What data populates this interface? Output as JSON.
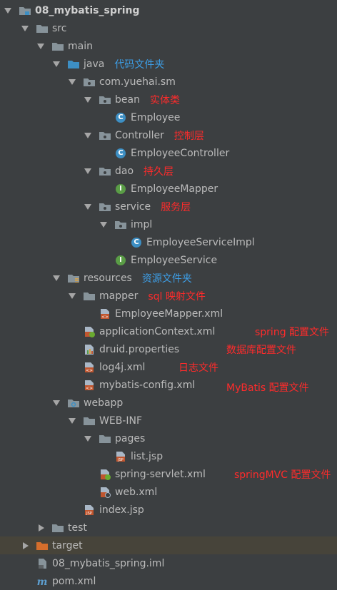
{
  "tree": {
    "project": "08_mybatis_spring",
    "src": "src",
    "main": "main",
    "java": "java",
    "java_note": "代码文件夹",
    "package": "com.yuehai.sm",
    "bean": "bean",
    "bean_note": "实体类",
    "employee": "Employee",
    "controller": "Controller",
    "controller_note": "控制层",
    "employee_controller": "EmployeeController",
    "dao": "dao",
    "dao_note": "持久层",
    "employee_mapper": "EmployeeMapper",
    "service": "service",
    "service_note": "服务层",
    "impl": "impl",
    "employee_service_impl": "EmployeeServiceImpl",
    "employee_service": "EmployeeService",
    "resources": "resources",
    "resources_note": "资源文件夹",
    "mapper": "mapper",
    "mapper_note": "sql 映射文件",
    "employee_mapper_xml": "EmployeeMapper.xml",
    "app_context": "applicationContext.xml",
    "app_context_note": "spring 配置文件",
    "druid": "druid.properties",
    "druid_note": "数据库配置文件",
    "log4j": "log4j.xml",
    "log4j_note": "日志文件",
    "mybatis_config": "mybatis-config.xml",
    "mybatis_config_note": "MyBatis 配置文件",
    "webapp": "webapp",
    "web_inf": "WEB-INF",
    "pages": "pages",
    "list_jsp": "list.jsp",
    "spring_servlet": "spring-servlet.xml",
    "spring_servlet_note": "springMVC 配置文件",
    "web_xml": "web.xml",
    "index_jsp": "index.jsp",
    "test": "test",
    "target": "target",
    "iml": "08_mybatis_spring.iml",
    "pom": "pom.xml"
  },
  "colors": {
    "background": "#3c3f41",
    "text": "#bbbbbb",
    "note_blue": "#3d9ee6",
    "note_red": "#ff2b2b",
    "class_icon": "#3d8fc4",
    "interface_icon": "#5a9d46",
    "target_folder": "#d56e2c"
  }
}
